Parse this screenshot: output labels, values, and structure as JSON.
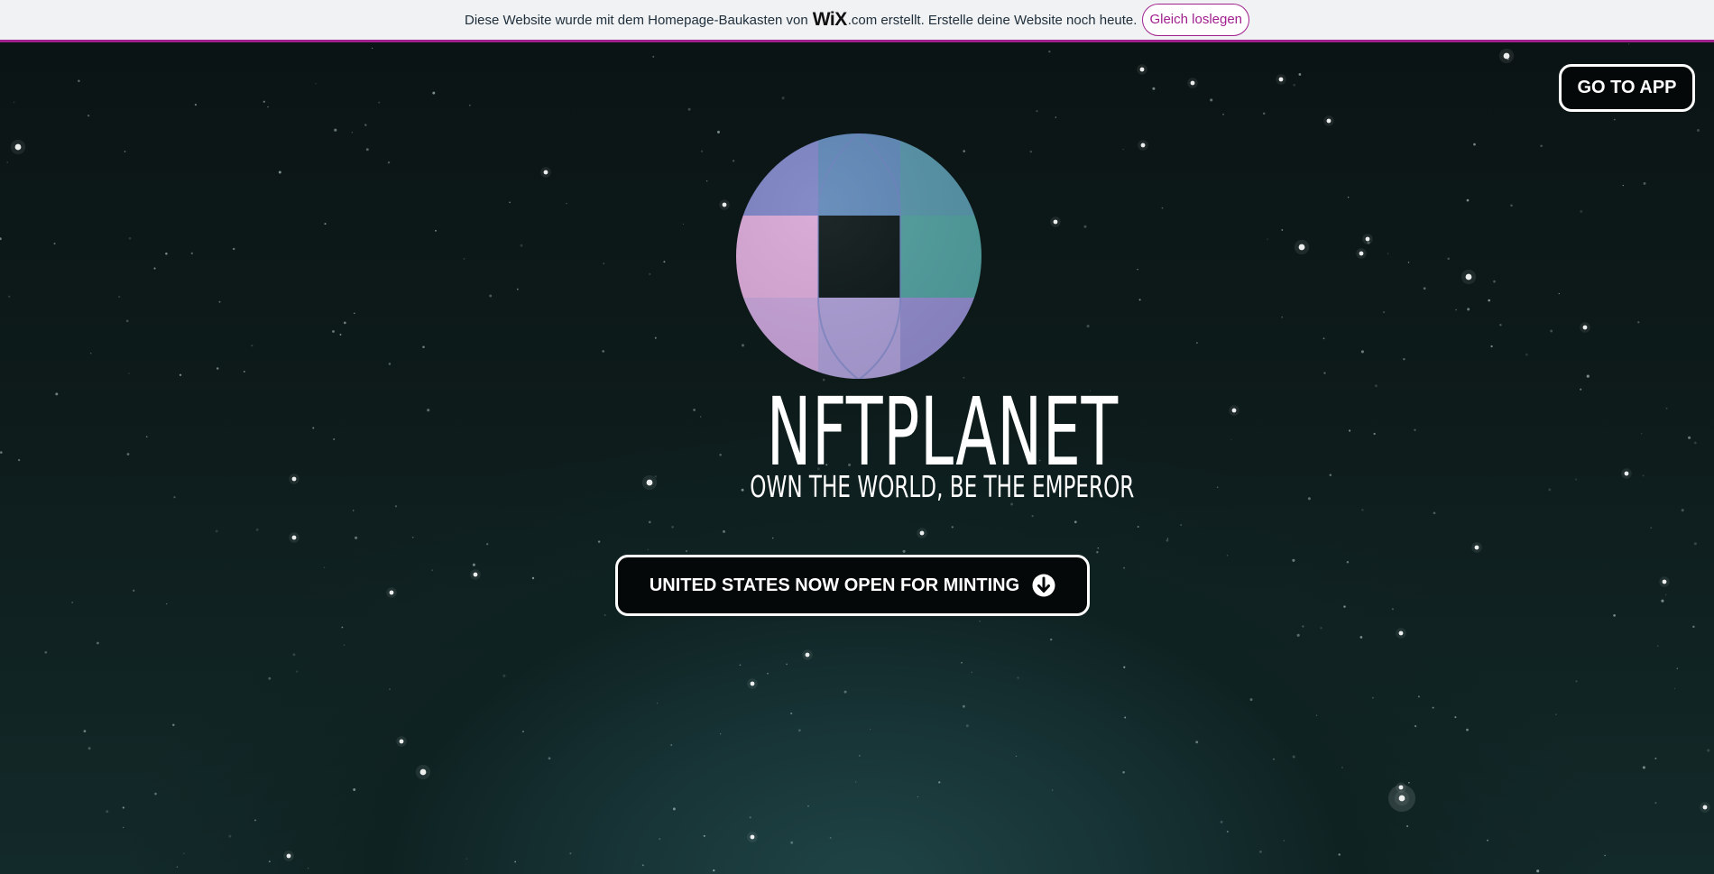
{
  "banner": {
    "text_before": "Diese Website wurde mit dem Homepage-Baukasten von",
    "wix_logo": "WiX",
    "text_after": ".com erstellt. Erstelle deine Website noch heute.",
    "cta_label": "Gleich loslegen"
  },
  "header": {
    "go_to_app_label": "GO TO APP"
  },
  "hero": {
    "logo_icon": "globe-logo-icon",
    "brand_title": "NFTPLANET",
    "brand_tagline": "OWN THE WORLD, BE THE EMPEROR",
    "mint_button_label": "UNITED STATES NOW OPEN FOR MINTING",
    "mint_button_icon": "arrow-down-circle-icon"
  },
  "colors": {
    "wix_accent": "#a0208e",
    "background_dark": "#0b1515",
    "globe_purple": "#7f82c4",
    "globe_teal": "#4e9b9e",
    "globe_pink": "#d6a6d4"
  }
}
